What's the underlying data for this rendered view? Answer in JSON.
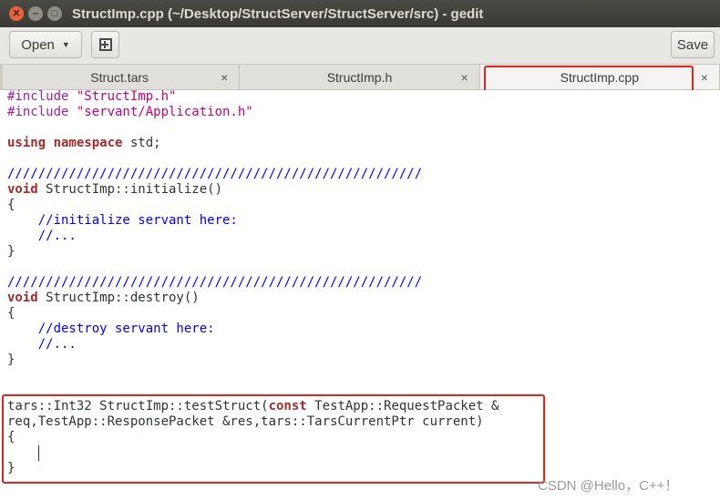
{
  "window": {
    "title": "StructImp.cpp (~/Desktop/StructServer/StructServer/src) - gedit",
    "close_glyph": "✕",
    "minimize_glyph": "‒",
    "maximize_glyph": "□"
  },
  "toolbar": {
    "open_label": "Open",
    "open_arrow": "▼",
    "new_tab_icon": "new-tab-icon",
    "save_label": "Save"
  },
  "tabs": [
    {
      "label": "Struct.tars",
      "close": "×"
    },
    {
      "label": "StructImp.h",
      "close": "×"
    },
    {
      "label": "StructImp.cpp",
      "close": "×",
      "active": true
    }
  ],
  "editor": {
    "lines": [
      "#include \"StructImp.h\"",
      "#include \"servant/Application.h\"",
      "",
      "using namespace std;",
      "",
      "//////////////////////////////////////////////////////",
      "void StructImp::initialize()",
      "{",
      "    //initialize servant here:",
      "    //...",
      "}",
      "",
      "//////////////////////////////////////////////////////",
      "void StructImp::destroy()",
      "{",
      "    //destroy servant here:",
      "    //...",
      "}",
      "",
      "",
      "tars::Int32 StructImp::testStruct(const TestApp::RequestPacket &",
      "req,TestApp::ResponsePacket &res,tars::TarsCurrentPtr current)",
      "{",
      "    ",
      "}"
    ]
  },
  "watermark": "CSDN @Hello，C++！",
  "colors": {
    "highlight_box": "#e3231c",
    "preprocessor": "#a020a0",
    "string": "#c4007a",
    "keyword": "#a52a2a",
    "comment": "#0000ff"
  }
}
